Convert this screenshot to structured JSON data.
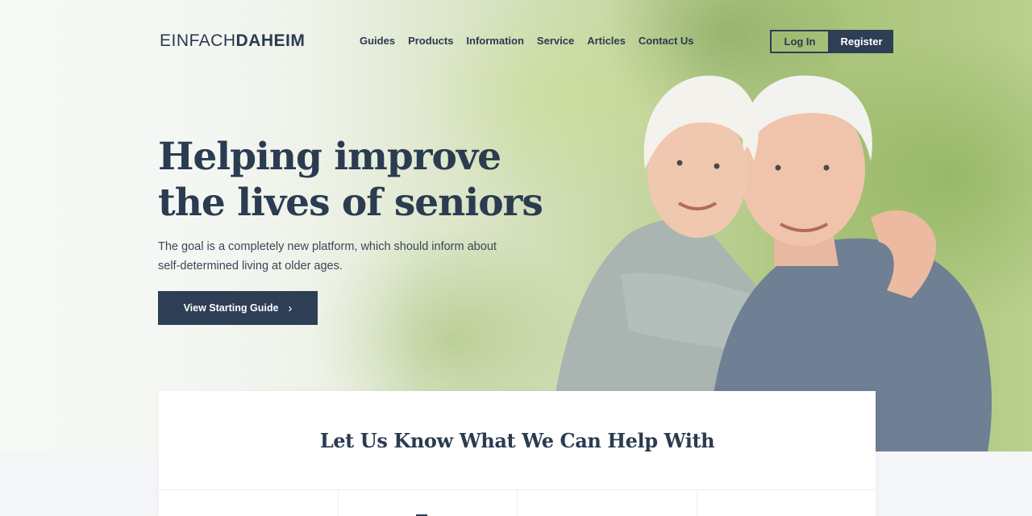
{
  "header": {
    "logo_light": "EINFACH",
    "logo_bold": "DAHEIM",
    "nav": [
      "Guides",
      "Products",
      "Information",
      "Service",
      "Articles",
      "Contact Us"
    ],
    "login_label": "Log In",
    "register_label": "Register"
  },
  "hero": {
    "headline_line1": "Helping improve",
    "headline_line2": "the lives of seniors",
    "subtext": "The goal is a completely new platform, which should inform about self-determined living at older ages.",
    "cta_label": "View Starting Guide",
    "cta_icon": "chevron-right-icon"
  },
  "help": {
    "title": "Let Us Know What We Can Help With",
    "categories": [
      "",
      "",
      "",
      ""
    ]
  },
  "colors": {
    "primary": "#2d3e55",
    "background": "#f5f6f7",
    "card": "#ffffff"
  }
}
